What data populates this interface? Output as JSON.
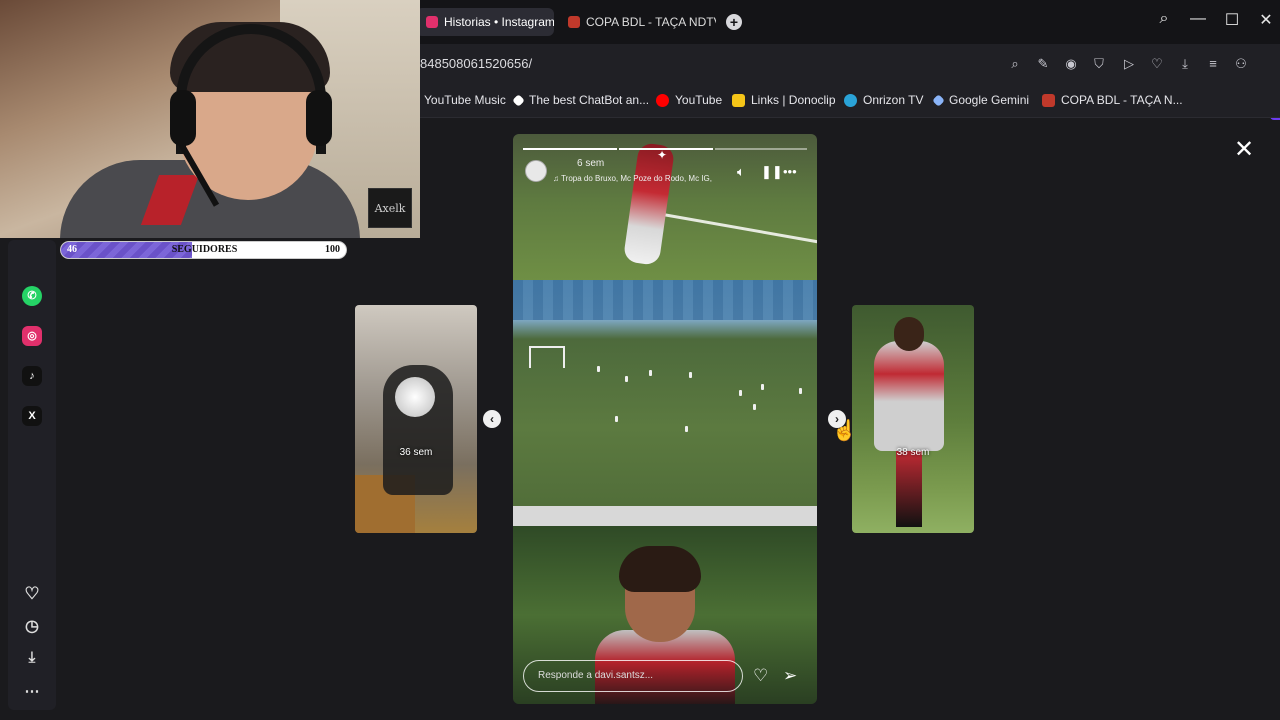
{
  "browser": {
    "tabs": [
      {
        "label": "Historias • Instagram",
        "active": true,
        "color": "#e1306c"
      },
      {
        "label": "COPA BDL - TAÇA NDTV R",
        "active": false,
        "color": "#c0392b"
      }
    ],
    "url": "848508061520656/",
    "bookmarks": [
      {
        "label": "YouTube Music",
        "icon": "youtube-music-icon",
        "color": "#ff0033"
      },
      {
        "label": "The best ChatBot an...",
        "icon": "chatbot-icon",
        "color": "#ffffff"
      },
      {
        "label": "YouTube",
        "icon": "youtube-icon",
        "color": "#ff0000"
      },
      {
        "label": "Links | Donoclip",
        "icon": "donoclip-icon",
        "color": "#f5c518"
      },
      {
        "label": "Onrizon TV",
        "icon": "onrizon-icon",
        "color": "#2aa3d8"
      },
      {
        "label": "Google Gemini",
        "icon": "gemini-icon",
        "color": "#8ab4f8"
      },
      {
        "label": "COPA BDL - TAÇA N...",
        "icon": "copa-icon",
        "color": "#c0392b"
      }
    ]
  },
  "stream_overlay": {
    "followers_current": "46",
    "followers_label": "SEGUIDORES",
    "followers_goal": "100",
    "followers_progress": 0.46,
    "cam_sign": "Axelk"
  },
  "sidebar": {
    "apps": [
      {
        "name": "whatsapp-icon",
        "color": "#25d366",
        "glyph": "✆"
      },
      {
        "name": "instagram-icon",
        "color": "#e1306c",
        "glyph": "◎"
      },
      {
        "name": "tiktok-icon",
        "color": "#111111",
        "glyph": "♪"
      },
      {
        "name": "x-icon",
        "color": "#111111",
        "glyph": "X"
      }
    ]
  },
  "story": {
    "time": "6 sem",
    "music": "Tropa do Bruxo, Mc Poze do Rodo, Mc IG,",
    "reply_placeholder": "Responde a davi.santsz...",
    "segments_total": 3,
    "segments_done": 2,
    "prev_time": "36 sem",
    "next_time": "38 sem"
  }
}
